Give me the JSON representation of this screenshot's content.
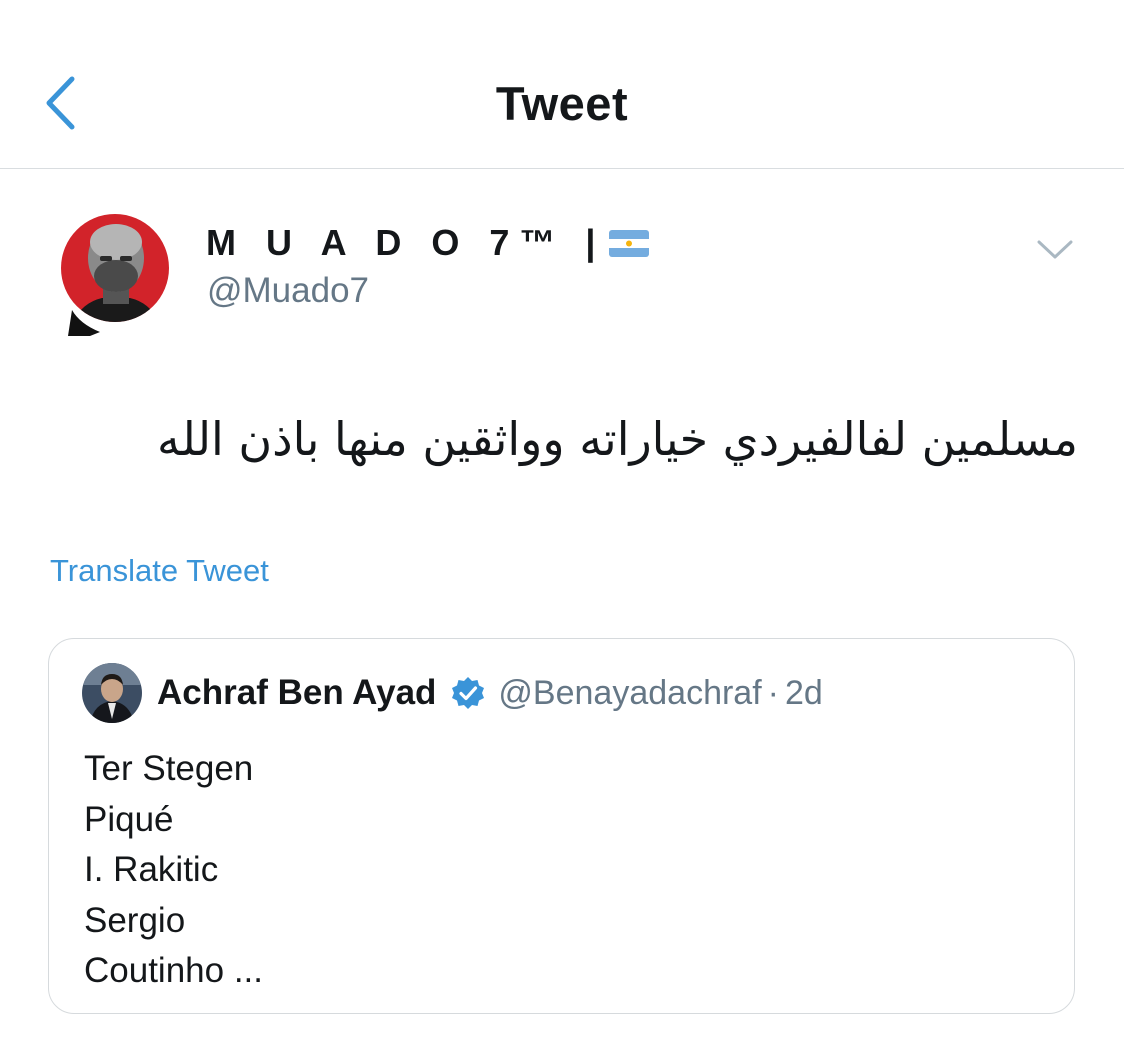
{
  "header": {
    "title": "Tweet",
    "back_icon": "chevron-left-icon"
  },
  "author": {
    "display_name": "M U A D O 7™ |",
    "flag_icon": "argentina-flag-icon",
    "handle": "@Muado7",
    "menu_icon": "chevron-down-icon"
  },
  "tweet": {
    "text": "مسلمين لفالفيردي خياراته وواثقين منها باذن الله",
    "translate_label": "Translate Tweet"
  },
  "quoted_tweet": {
    "name": "Achraf Ben Ayad",
    "verified_icon": "verified-badge-icon",
    "handle": "@Benayadachraf",
    "separator": "·",
    "time": "2d",
    "lines": [
      "Ter Stegen",
      "Piqué",
      "I. Rakitic",
      "Sergio",
      "Coutinho ..."
    ]
  },
  "colors": {
    "accent": "#3a94d8",
    "text": "#14171a",
    "secondary_text": "#657786",
    "divider": "#d9dde0",
    "avatar_ring": "#d2232a"
  }
}
